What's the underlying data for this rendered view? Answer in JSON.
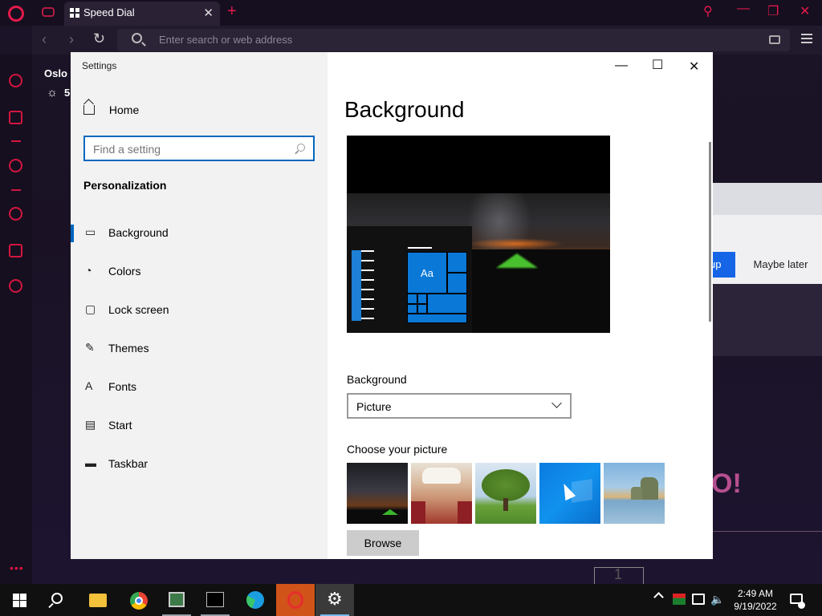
{
  "browser": {
    "tab_title": "Speed Dial",
    "address_placeholder": "Enter search or web address",
    "weather": {
      "city": "Oslo",
      "temperature": "5"
    },
    "popup": {
      "primary_label": "up",
      "secondary_label": "Maybe later"
    },
    "speed_dial_text": "O!",
    "speed_tile_label": "1"
  },
  "settings": {
    "window_title": "Settings",
    "home_label": "Home",
    "search_placeholder": "Find a setting",
    "section_title": "Personalization",
    "nav_items": [
      {
        "label": "Background",
        "icon": "picture-icon",
        "active": true
      },
      {
        "label": "Colors",
        "icon": "palette-icon"
      },
      {
        "label": "Lock screen",
        "icon": "lock-screen-icon"
      },
      {
        "label": "Themes",
        "icon": "themes-icon"
      },
      {
        "label": "Fonts",
        "icon": "fonts-icon"
      },
      {
        "label": "Start",
        "icon": "start-icon"
      },
      {
        "label": "Taskbar",
        "icon": "taskbar-icon"
      }
    ],
    "page_title": "Background",
    "preview_tile_text": "Aa",
    "background_label": "Background",
    "background_value": "Picture",
    "choose_picture_label": "Choose your picture",
    "browse_label": "Browse"
  },
  "taskbar": {
    "time": "2:49 AM",
    "date": "9/19/2022",
    "accent": "#0067c0"
  }
}
